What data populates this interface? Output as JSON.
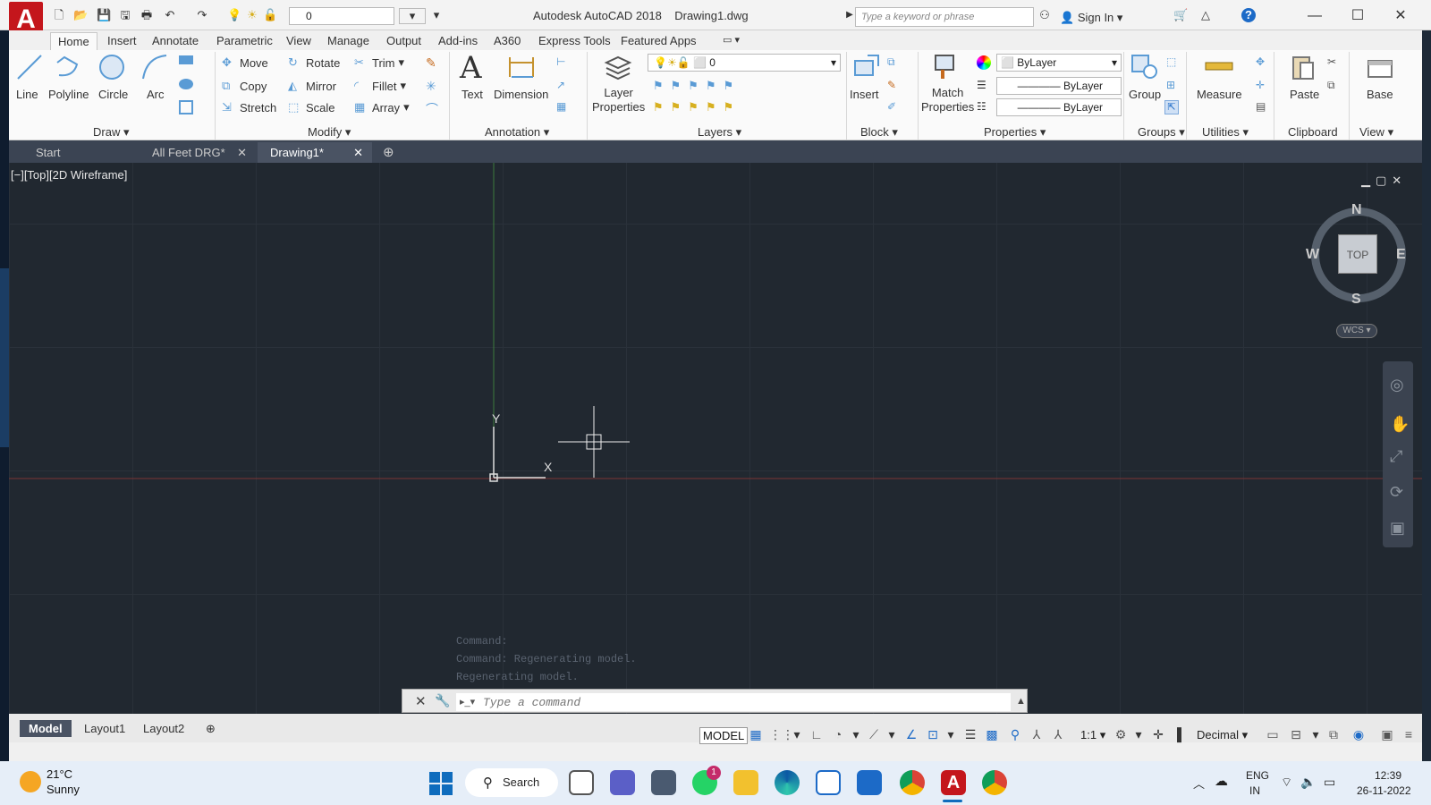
{
  "titlebar": {
    "app_title": "Autodesk AutoCAD 2018",
    "file_name": "Drawing1.dwg",
    "qat_layer": "0",
    "search_placeholder": "Type a keyword or phrase",
    "sign_in": "Sign In",
    "help": "?"
  },
  "ribbon_tabs": [
    "Home",
    "Insert",
    "Annotate",
    "Parametric",
    "View",
    "Manage",
    "Output",
    "Add-ins",
    "A360",
    "Express Tools",
    "Featured Apps"
  ],
  "ribbon": {
    "draw": {
      "line": "Line",
      "polyline": "Polyline",
      "circle": "Circle",
      "arc": "Arc",
      "label": "Draw"
    },
    "modify": {
      "move": "Move",
      "rotate": "Rotate",
      "trim": "Trim",
      "copy": "Copy",
      "mirror": "Mirror",
      "fillet": "Fillet",
      "stretch": "Stretch",
      "scale": "Scale",
      "array": "Array",
      "label": "Modify"
    },
    "annotation": {
      "text": "Text",
      "dimension": "Dimension",
      "label": "Annotation"
    },
    "layers": {
      "layer_properties_1": "Layer",
      "layer_properties_2": "Properties",
      "current_layer": "0",
      "label": "Layers"
    },
    "block": {
      "insert": "Insert",
      "label": "Block"
    },
    "properties": {
      "match_1": "Match",
      "match_2": "Properties",
      "color": "ByLayer",
      "linetype": "ByLayer",
      "lineweight": "ByLayer",
      "label": "Properties"
    },
    "groups": {
      "group": "Group",
      "label": "Groups"
    },
    "utilities": {
      "measure": "Measure",
      "label": "Utilities"
    },
    "clipboard": {
      "paste": "Paste",
      "label": "Clipboard"
    },
    "view": {
      "base": "Base",
      "label": "View"
    }
  },
  "file_tabs": [
    {
      "label": "Start"
    },
    {
      "label": "All Feet DRG*"
    },
    {
      "label": "Drawing1*"
    }
  ],
  "viewport": {
    "label": "[−][Top][2D Wireframe]",
    "ucs_y": "Y",
    "ucs_x": "X",
    "viewcube": {
      "n": "N",
      "s": "S",
      "e": "E",
      "w": "W",
      "face": "TOP",
      "wcs": "WCS"
    }
  },
  "command": {
    "history": [
      "Command:",
      "Command: Regenerating model.",
      "Regenerating model."
    ],
    "placeholder": "Type a command"
  },
  "layout_tabs": [
    "Model",
    "Layout1",
    "Layout2"
  ],
  "status": {
    "model": "MODEL",
    "scale": "1:1",
    "units": "Decimal"
  },
  "taskbar": {
    "temp": "21°C",
    "weather": "Sunny",
    "search": "Search",
    "lang1": "ENG",
    "lang2": "IN",
    "time": "12:39",
    "date": "26-11-2022",
    "whatsapp_badge": "1"
  },
  "colors": {
    "accent": "#c4161c",
    "viewport_bg": "#212830",
    "ribbon_bg": "#fafafa",
    "y_axis": "#3d7a3d",
    "x_axis": "#7a3535"
  }
}
